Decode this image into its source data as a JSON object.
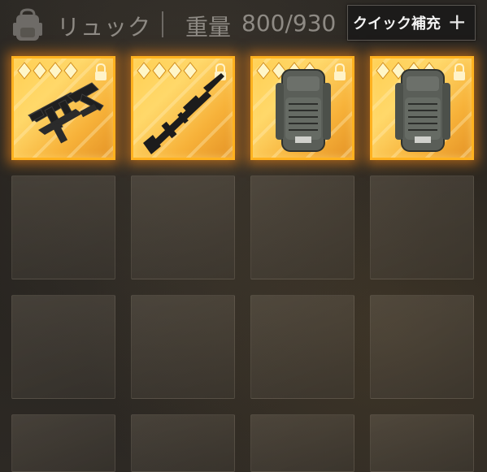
{
  "header": {
    "icon": "backpack-icon",
    "title": "リュック",
    "weight_label": "重量",
    "weight_value": "800/930",
    "quick_button_label": "クイック補充",
    "quick_button_icon": "plus-icon"
  },
  "colors": {
    "gold_border": "#ffb21f",
    "gold_fill": "#ffd86a",
    "text_muted": "#8e8a84"
  },
  "slots": [
    {
      "type": "item",
      "item": "submachine-gun",
      "rarity_stars": 4,
      "locked": true
    },
    {
      "type": "item",
      "item": "assault-rifle",
      "rarity_stars": 4,
      "locked": true
    },
    {
      "type": "item",
      "item": "backpack",
      "rarity_stars": 4,
      "locked": true
    },
    {
      "type": "item",
      "item": "backpack",
      "rarity_stars": 4,
      "locked": true
    }
  ]
}
